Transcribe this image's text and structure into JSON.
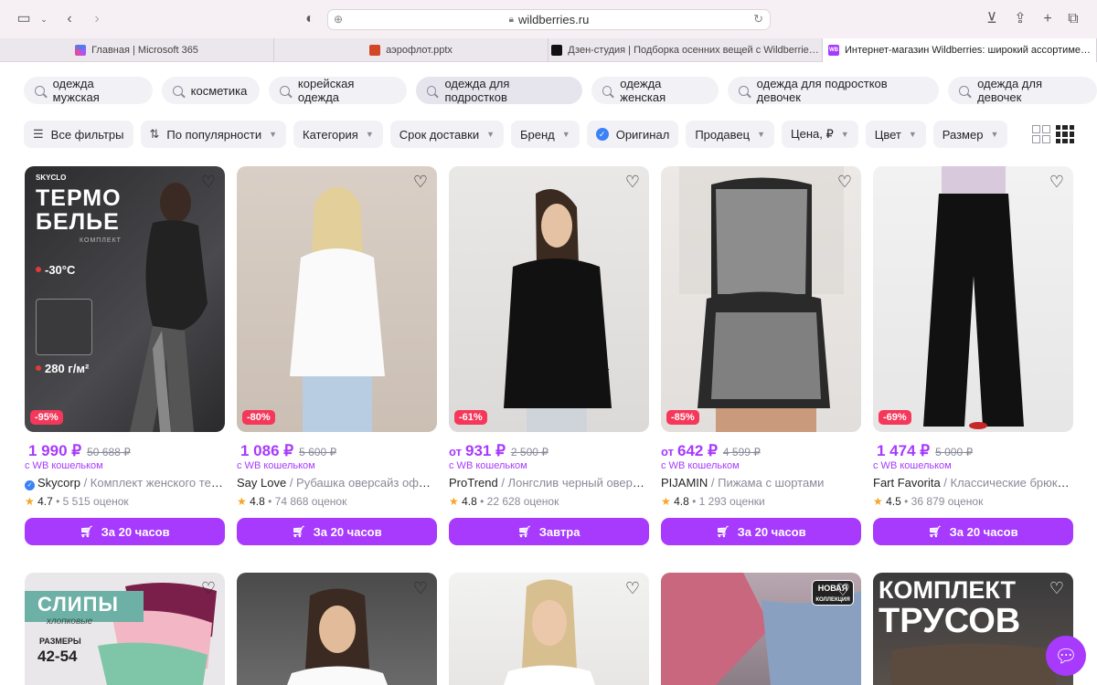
{
  "browser": {
    "url": "wildberries.ru",
    "tabs": [
      {
        "label": "Главная | Microsoft 365",
        "color": "#3b82f6"
      },
      {
        "label": "аэрофлот.pptx",
        "color": "#d24726"
      },
      {
        "label": "Дзен-студия | Подборка осенних вещей с Wildberrie…",
        "color": "#111111"
      },
      {
        "label": "Интернет-магазин Wildberries: широкий ассортиме…",
        "color": "#a73afd",
        "favicon_text": "WB"
      }
    ]
  },
  "search_chips": [
    "одежда мужская",
    "косметика",
    "корейская одежда",
    "одежда для подростков",
    "одежда женская",
    "одежда для подростков девочек",
    "одежда для девочек"
  ],
  "filters": {
    "all": "Все фильтры",
    "sort": "По популярности",
    "category": "Категория",
    "delivery": "Срок доставки",
    "brand": "Бренд",
    "original": "Оригинал",
    "seller": "Продавец",
    "price": "Цена, ₽",
    "color": "Цвет",
    "size": "Размер"
  },
  "wallet_label": "с WB кошельком",
  "products": [
    {
      "price_prefix": "",
      "price": "1 990 ₽",
      "old_price": "50 688 ₽",
      "discount": "-95%",
      "brand": "Skycorp",
      "verified": true,
      "desc": " / Комплект женского термобелья",
      "rating": "4.7",
      "reviews": " • 5 515 оценок",
      "button": "За 20 часов"
    },
    {
      "price_prefix": "",
      "price": "1 086 ₽",
      "old_price": "5 600 ₽",
      "discount": "-80%",
      "brand": "Say Love",
      "verified": false,
      "desc": " / Рубашка оверсайз офисная",
      "rating": "4.8",
      "reviews": " • 74 868 оценок",
      "button": "За 20 часов"
    },
    {
      "price_prefix": "от",
      "price": "931 ₽",
      "old_price": "2 500 ₽",
      "discount": "-61%",
      "brand": "ProTrend",
      "verified": false,
      "desc": " / Лонгслив черный оверсайз",
      "rating": "4.8",
      "reviews": " • 22 628 оценок",
      "button": "Завтра"
    },
    {
      "price_prefix": "от",
      "price": "642 ₽",
      "old_price": "4 599 ₽",
      "discount": "-85%",
      "brand": "PIJAMIN",
      "verified": false,
      "desc": " / Пижама с шортами",
      "rating": "4.8",
      "reviews": " • 1 293 оценки",
      "button": "За 20 часов"
    },
    {
      "price_prefix": "",
      "price": "1 474 ₽",
      "old_price": "5 000 ₽",
      "discount": "-69%",
      "brand": "Fart Favorita",
      "verified": false,
      "desc": " / Классические брюки палаццо",
      "rating": "4.5",
      "reviews": " • 36 879 оценок",
      "button": "За 20 часов"
    }
  ],
  "promo": {
    "p1_logo": "SKYCLO",
    "p1_title_1": "ТЕРМО",
    "p1_title_2": "БЕЛЬЕ",
    "p1_sub": "КОМПЛЕКТ",
    "p1_temp": "-30°C",
    "p1_density": "280 г/м²",
    "p6_title": "СЛИПЫ",
    "p6_sub": "хлопковые",
    "p6_sizes_label": "РАЗМЕРЫ",
    "p6_sizes": "42-54",
    "p9_badge_1": "НОВАЯ",
    "p9_badge_2": "КОЛЛЕКЦИЯ",
    "p10_title_1": "КОМПЛЕКТ",
    "p10_title_2": "ТРУСОВ"
  }
}
